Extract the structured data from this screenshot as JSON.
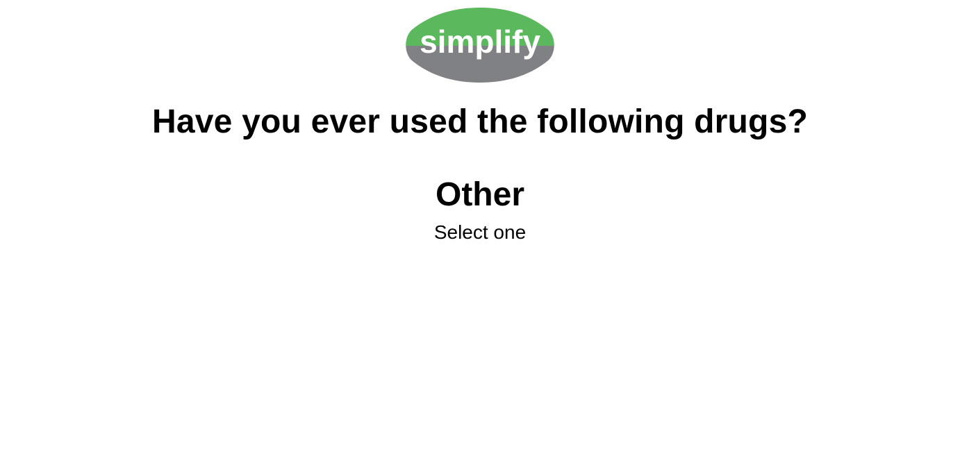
{
  "logo": {
    "text": "simplify",
    "colors": {
      "top": "#5cb85c",
      "bottom": "#808184",
      "text": "#ffffff"
    }
  },
  "question": {
    "title": "Have you ever used the following drugs?"
  },
  "category": {
    "label": "Other",
    "instruction": "Select one"
  }
}
